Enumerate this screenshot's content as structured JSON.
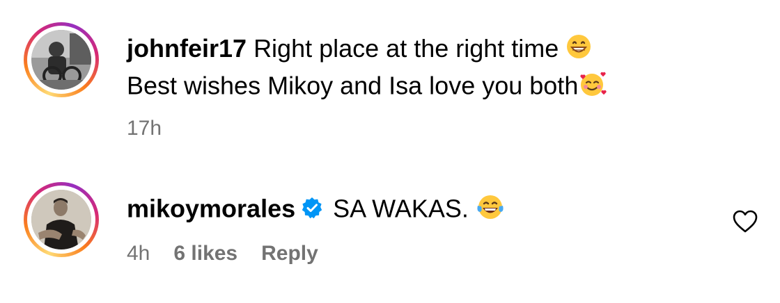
{
  "comments": [
    {
      "username": "johnfeir17",
      "line1_text": "Right place at the right time",
      "line1_emoji": "grinning-face-emoji",
      "line2_text": "Best wishes Mikoy and Isa love you both",
      "line2_emoji": "smiling-face-with-hearts-emoji",
      "time": "17h"
    },
    {
      "username": "mikoymorales",
      "verified": true,
      "text": "SA WAKAS.",
      "emoji": "face-with-tears-of-joy-emoji",
      "time": "4h",
      "likes": "6 likes",
      "reply_label": "Reply"
    }
  ],
  "colors": {
    "meta_text": "#737373",
    "verified_blue": "#0095f6",
    "ring_gradient": [
      "#feda75",
      "#fa7e1e",
      "#d62976",
      "#962fbf"
    ]
  },
  "icons": [
    "heart-outline-icon",
    "verified-badge-icon"
  ]
}
